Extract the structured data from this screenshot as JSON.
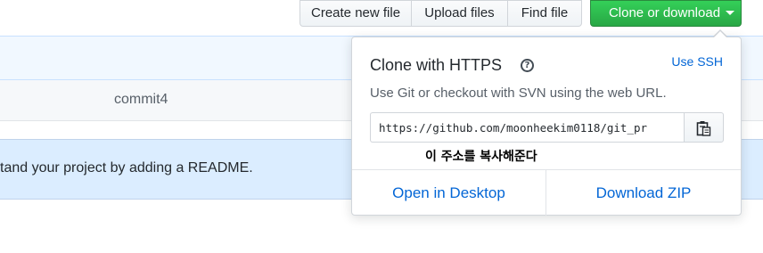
{
  "toolbar": {
    "create_new_file": "Create new file",
    "upload_files": "Upload files",
    "find_file": "Find file",
    "clone_or_download": "Clone or download"
  },
  "page": {
    "commit_message": "commit4",
    "readme_prompt": "tand your project by adding a README."
  },
  "clone_panel": {
    "title": "Clone with HTTPS",
    "help_icon": "question-circle-icon",
    "use_ssh": "Use SSH",
    "description": "Use Git or checkout with SVN using the web URL.",
    "url_value": "https://github.com/moonheekim0118/git_pr",
    "copy_icon": "clipboard-icon",
    "annotation": "이 주소를 복사해준다",
    "open_in_desktop": "Open in Desktop",
    "download_zip": "Download ZIP"
  },
  "colors": {
    "primary_green": "#28a745",
    "link_blue": "#0366d6",
    "readme_bg": "#dbedff"
  }
}
